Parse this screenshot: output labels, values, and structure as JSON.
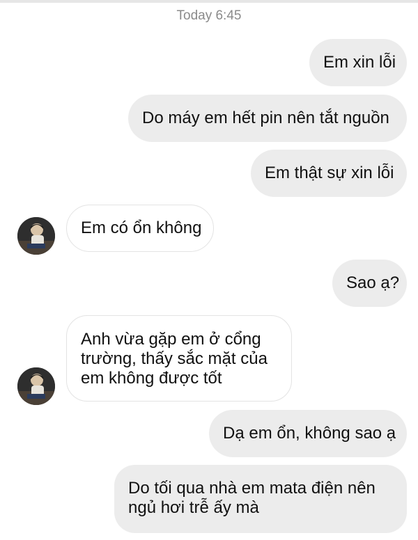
{
  "header": {
    "timestamp": "Today 6:45"
  },
  "messages": [
    {
      "side": "out",
      "text": "Em xin lỗi"
    },
    {
      "side": "out",
      "text": "Do máy em hết pin nên tắt nguồn"
    },
    {
      "side": "out",
      "text": "Em thật sự xin lỗi"
    },
    {
      "side": "in",
      "text": "Em có ổn không"
    },
    {
      "side": "out",
      "text": "Sao ạ?"
    },
    {
      "side": "in",
      "lines": [
        "Anh vừa gặp em ở cổng",
        "trường, thấy sắc mặt của",
        "em không được tốt"
      ]
    },
    {
      "side": "out",
      "text": "Dạ em ổn, không sao ạ"
    },
    {
      "side": "out",
      "lines": [
        "Do tối qua nhà em mata điện nên",
        "ngủ hơi trễ ấy mà"
      ]
    }
  ],
  "contact": {
    "avatar_icon": "contact-avatar"
  },
  "colors": {
    "outgoing_bubble": "#ececec",
    "incoming_bubble": "#ffffff",
    "timestamp": "#8a8a8a"
  }
}
